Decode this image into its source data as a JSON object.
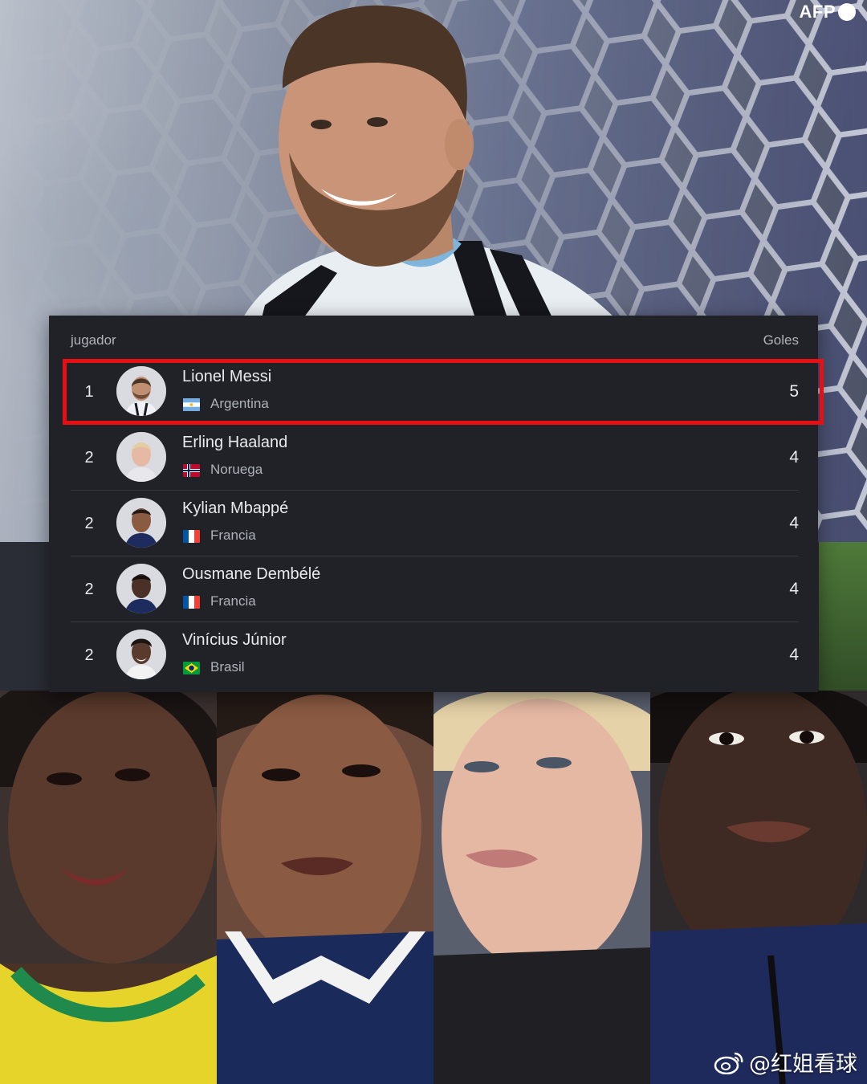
{
  "watermark_top": "AFP",
  "watermark_bottom": "@红姐看球",
  "table": {
    "header_player": "jugador",
    "header_goals": "Goles",
    "highlight_color": "#e80f14",
    "rows": [
      {
        "rank": "1",
        "name": "Lionel Messi",
        "country": "Argentina",
        "flag": "argentina-flag-icon",
        "goals": "5",
        "highlighted": true
      },
      {
        "rank": "2",
        "name": "Erling Haaland",
        "country": "Noruega",
        "flag": "norway-flag-icon",
        "goals": "4",
        "highlighted": false
      },
      {
        "rank": "2",
        "name": "Kylian Mbappé",
        "country": "Francia",
        "flag": "france-flag-icon",
        "goals": "4",
        "highlighted": false
      },
      {
        "rank": "2",
        "name": "Ousmane Dembélé",
        "country": "Francia",
        "flag": "france-flag-icon",
        "goals": "4",
        "highlighted": false
      },
      {
        "rank": "2",
        "name": "Vinícius Júnior",
        "country": "Brasil",
        "flag": "brazil-flag-icon",
        "goals": "4",
        "highlighted": false
      }
    ]
  },
  "colors": {
    "panel_background": "#202227",
    "text_primary": "#e8eaed",
    "text_secondary": "#aeb3ba"
  }
}
